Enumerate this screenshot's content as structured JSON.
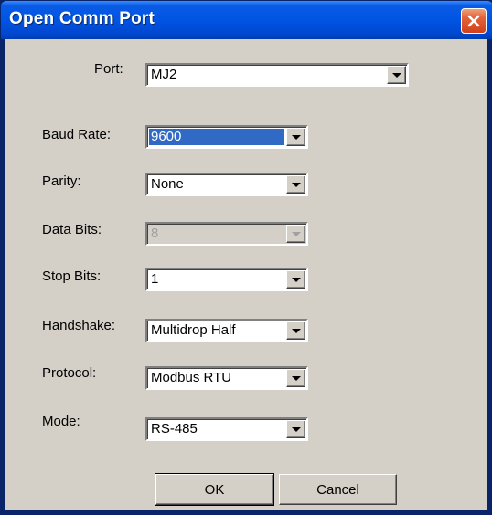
{
  "window": {
    "title": "Open Comm Port"
  },
  "fields": {
    "port": {
      "label": "Port:",
      "value": "MJ2"
    },
    "baud_rate": {
      "label": "Baud Rate:",
      "value": "9600"
    },
    "parity": {
      "label": "Parity:",
      "value": "None"
    },
    "data_bits": {
      "label": "Data Bits:",
      "value": "8",
      "disabled": true
    },
    "stop_bits": {
      "label": "Stop Bits:",
      "value": "1"
    },
    "handshake": {
      "label": "Handshake:",
      "value": "Multidrop Half"
    },
    "protocol": {
      "label": "Protocol:",
      "value": "Modbus RTU"
    },
    "mode": {
      "label": "Mode:",
      "value": "RS-485"
    }
  },
  "buttons": {
    "ok": "OK",
    "cancel": "Cancel"
  },
  "icons": {
    "close": "close-icon",
    "dropdown": "chevron-down-icon"
  },
  "colors": {
    "titlebar": "#0054e3",
    "close_button": "#e2633b",
    "dialog_face": "#d4d0c8",
    "selection": "#316ac5"
  }
}
